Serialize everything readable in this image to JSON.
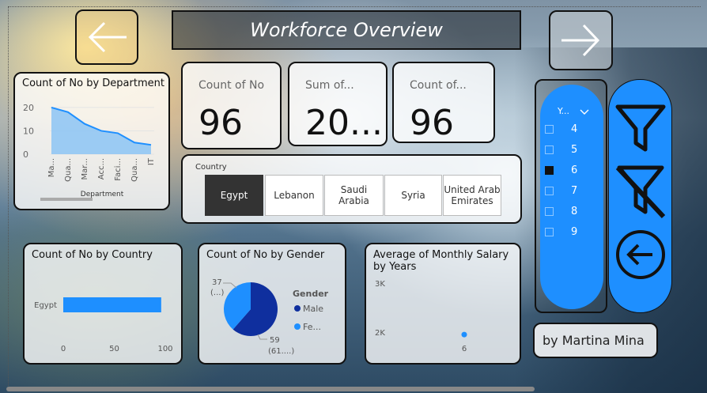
{
  "header": {
    "title": "Workforce Overview",
    "back_icon": "arrow-left-icon",
    "forward_icon": "arrow-right-icon"
  },
  "kpis": [
    {
      "label": "Count of No",
      "value": "96"
    },
    {
      "label": "Sum of...",
      "value": "20..."
    },
    {
      "label": "Count of...",
      "value": "96"
    }
  ],
  "country_slicer": {
    "title": "Country",
    "options": [
      "Egypt",
      "Lebanon",
      "Saudi Arabia",
      "Syria",
      "United Arab Emirates"
    ],
    "selected": "Egypt"
  },
  "year_slicer": {
    "header": "Y...",
    "items": [
      "4",
      "5",
      "6",
      "7",
      "8",
      "9"
    ],
    "selected": "6"
  },
  "tools": [
    "filter-icon",
    "clear-filter-icon",
    "back-circle-icon"
  ],
  "author": "by Martina Mina",
  "colors": {
    "accent": "#1e8fff",
    "area": "#8cc4f5",
    "pie_dark": "#0f2f9e",
    "pie_light": "#1e8fff"
  },
  "chart_data": [
    {
      "type": "area",
      "title": "Count of No by Department",
      "xlabel": "Department",
      "ylabel": "",
      "categories": [
        "Ma...",
        "Qua...",
        "Mar...",
        "Acc...",
        "Faci...",
        "Qua...",
        "IT"
      ],
      "values": [
        20,
        18,
        13,
        10,
        9,
        5,
        4
      ],
      "yticks": [
        "20",
        "10",
        "0"
      ],
      "ylim": [
        0,
        22
      ]
    },
    {
      "type": "bar",
      "title": "Count of No by Country",
      "categories": [
        "Egypt"
      ],
      "values": [
        96
      ],
      "xticks": [
        "0",
        "50",
        "100"
      ],
      "xlim": [
        0,
        100
      ]
    },
    {
      "type": "pie",
      "title": "Count of No by Gender",
      "legend_title": "Gender",
      "legend": [
        "Male",
        "Fe..."
      ],
      "slices": [
        {
          "name": "Male",
          "value": 59,
          "label_value": "59",
          "label_pct": "(61....)"
        },
        {
          "name": "Fe...",
          "value": 37,
          "label_value": "37",
          "label_pct": "(...)"
        }
      ]
    },
    {
      "type": "scatter",
      "title": "Average of Monthly Salary by Years",
      "yticks": [
        "3K",
        "2K"
      ],
      "xticks": [
        "6"
      ],
      "points": [
        {
          "x": 6,
          "y": 1950
        }
      ],
      "ylim": [
        1500,
        3000
      ]
    }
  ]
}
